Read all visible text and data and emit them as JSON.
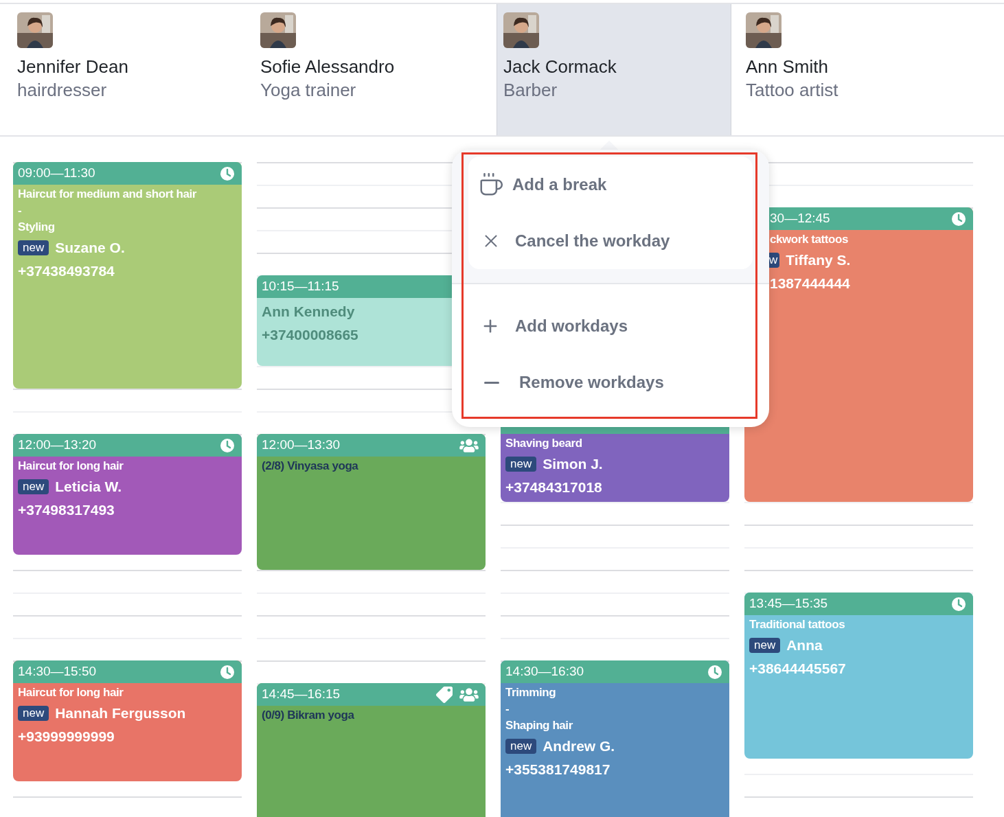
{
  "staff": [
    {
      "name": "Jennifer Dean",
      "role": "hairdresser",
      "selected": false
    },
    {
      "name": "Sofie Alessandro",
      "role": "Yoga trainer",
      "selected": false
    },
    {
      "name": "Jack Cormack",
      "role": "Barber",
      "selected": true
    },
    {
      "name": "Ann Smith",
      "role": "Tattoo artist",
      "selected": false
    }
  ],
  "columns": [
    {
      "cards": [
        {
          "kind": "appointment",
          "time": "09:00—11:30",
          "icons": [
            {
              "kind": "clock"
            }
          ],
          "color": "#aacb77",
          "title": [
            "Haircut for medium and short hair",
            "-",
            "Styling"
          ],
          "badge": "new",
          "client": "Suzane O.",
          "phone": "+37438493784"
        },
        {
          "kind": "appointment",
          "time": "12:00—13:20",
          "icons": [
            {
              "kind": "clock"
            }
          ],
          "color": "#a259b8",
          "title": [
            "Haircut for long hair"
          ],
          "badge": "new",
          "client": "Leticia W.",
          "phone": "+37498317493"
        },
        {
          "kind": "appointment",
          "time": "14:30—15:50",
          "icons": [
            {
              "kind": "clock"
            }
          ],
          "color": "#e87467",
          "title": [
            "Haircut for long hair"
          ],
          "badge": "new",
          "client": "Hannah Fergusson",
          "phone": "+93999999999"
        }
      ]
    },
    {
      "cards": [
        {
          "kind": "plain",
          "time": "10:15—11:15",
          "color": "#aee3d7",
          "client": "Ann Kennedy",
          "phone": "+37400008665"
        },
        {
          "kind": "class",
          "time": "12:00—13:30",
          "icons": [
            {
              "kind": "group"
            }
          ],
          "color": "#6aaa5a",
          "title": [
            "(2/8) Vinyasa yoga"
          ]
        },
        {
          "kind": "class",
          "time": "14:45—16:15",
          "icons": [
            {
              "kind": "tag"
            },
            {
              "kind": "group"
            }
          ],
          "color": "#6aaa5a",
          "title": [
            "(0/9) Bikram yoga"
          ]
        }
      ]
    },
    {
      "cards": [
        {
          "kind": "covered",
          "color": "#8064be",
          "title": [
            "Shaving beard"
          ],
          "badge": "new",
          "client": "Simon J.",
          "phone": "+37484317018"
        },
        {
          "kind": "appointment",
          "time": "14:30—16:30",
          "icons": [
            {
              "kind": "clock"
            }
          ],
          "color": "#5a8fbe",
          "title": [
            "Trimming",
            "-",
            "Shaping hair"
          ],
          "badge": "new",
          "client": "Andrew G.",
          "phone": "+355381749817"
        }
      ]
    },
    {
      "cards": [
        {
          "kind": "partial",
          "time": "30—12:45",
          "icons": [
            {
              "kind": "clock"
            }
          ],
          "color": "#e8836b",
          "title": [
            "ckwork tattoos"
          ],
          "badge": "w",
          "client": "Tiffany S.",
          "phone": "1387444444"
        },
        {
          "kind": "appointment",
          "time": "13:45—15:35",
          "icons": [
            {
              "kind": "clock"
            }
          ],
          "color": "#75c5da",
          "title": [
            "Traditional tattoos"
          ],
          "badge": "new",
          "client": "Anna",
          "phone": "+38644445567"
        }
      ]
    }
  ],
  "menu": {
    "groups": [
      {
        "items": [
          {
            "kind": "break",
            "label": "Add a break"
          },
          {
            "kind": "cancel",
            "label": "Cancel the workday"
          }
        ]
      },
      {
        "items": [
          {
            "kind": "add",
            "label": "Add workdays"
          },
          {
            "kind": "remove",
            "label": "Remove workdays"
          }
        ]
      }
    ]
  }
}
